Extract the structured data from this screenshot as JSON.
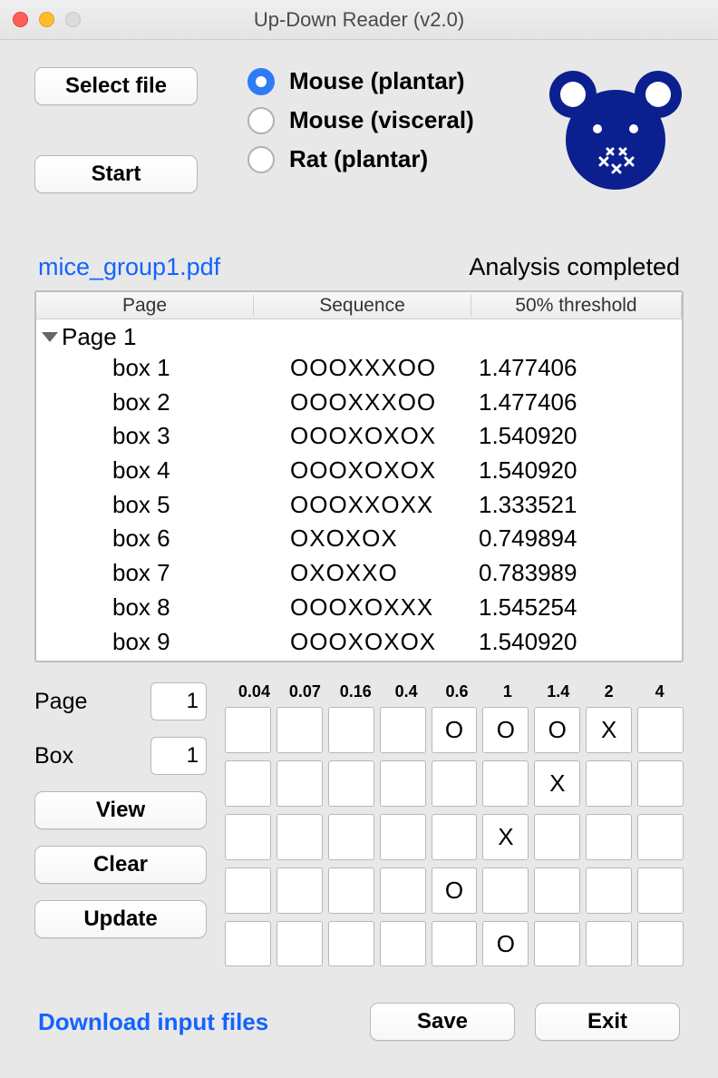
{
  "window": {
    "title": "Up-Down Reader (v2.0)"
  },
  "buttons": {
    "select_file": "Select file",
    "start": "Start",
    "view": "View",
    "clear": "Clear",
    "update": "Update",
    "save": "Save",
    "exit": "Exit"
  },
  "radios": {
    "mouse_plantar": "Mouse (plantar)",
    "mouse_visceral": "Mouse (visceral)",
    "rat_plantar": "Rat (plantar)",
    "selected": "mouse_plantar"
  },
  "file": {
    "name": "mice_group1.pdf",
    "status": "Analysis completed"
  },
  "table": {
    "headers": {
      "page": "Page",
      "sequence": "Sequence",
      "threshold": "50% threshold"
    },
    "group": "Page 1",
    "rows": [
      {
        "box": "box 1",
        "seq": "OOOXXXOO",
        "thr": "1.477406"
      },
      {
        "box": "box 2",
        "seq": "OOOXXXOO",
        "thr": "1.477406"
      },
      {
        "box": "box 3",
        "seq": "OOOXOXOX",
        "thr": "1.540920"
      },
      {
        "box": "box 4",
        "seq": "OOOXOXOX",
        "thr": "1.540920"
      },
      {
        "box": "box 5",
        "seq": "OOOXXOXX",
        "thr": "1.333521"
      },
      {
        "box": "box 6",
        "seq": "OXOXOX",
        "thr": "0.749894"
      },
      {
        "box": "box 7",
        "seq": "OXOXXO",
        "thr": "0.783989"
      },
      {
        "box": "box 8",
        "seq": "OOOXOXXX",
        "thr": "1.545254"
      },
      {
        "box": "box 9",
        "seq": "OOOXOXOX",
        "thr": "1.540920"
      }
    ]
  },
  "editor": {
    "labels": {
      "page": "Page",
      "box": "Box"
    },
    "page_value": "1",
    "box_value": "1",
    "grid_headers": [
      "0.04",
      "0.07",
      "0.16",
      "0.4",
      "0.6",
      "1",
      "1.4",
      "2",
      "4"
    ],
    "grid": [
      [
        "",
        "",
        "",
        "",
        "O",
        "O",
        "O",
        "X",
        ""
      ],
      [
        "",
        "",
        "",
        "",
        "",
        "",
        "X",
        "",
        ""
      ],
      [
        "",
        "",
        "",
        "",
        "",
        "X",
        "",
        "",
        ""
      ],
      [
        "",
        "",
        "",
        "",
        "O",
        "",
        "",
        "",
        ""
      ],
      [
        "",
        "",
        "",
        "",
        "",
        "O",
        "",
        "",
        ""
      ]
    ]
  },
  "footer": {
    "download": "Download input files"
  }
}
